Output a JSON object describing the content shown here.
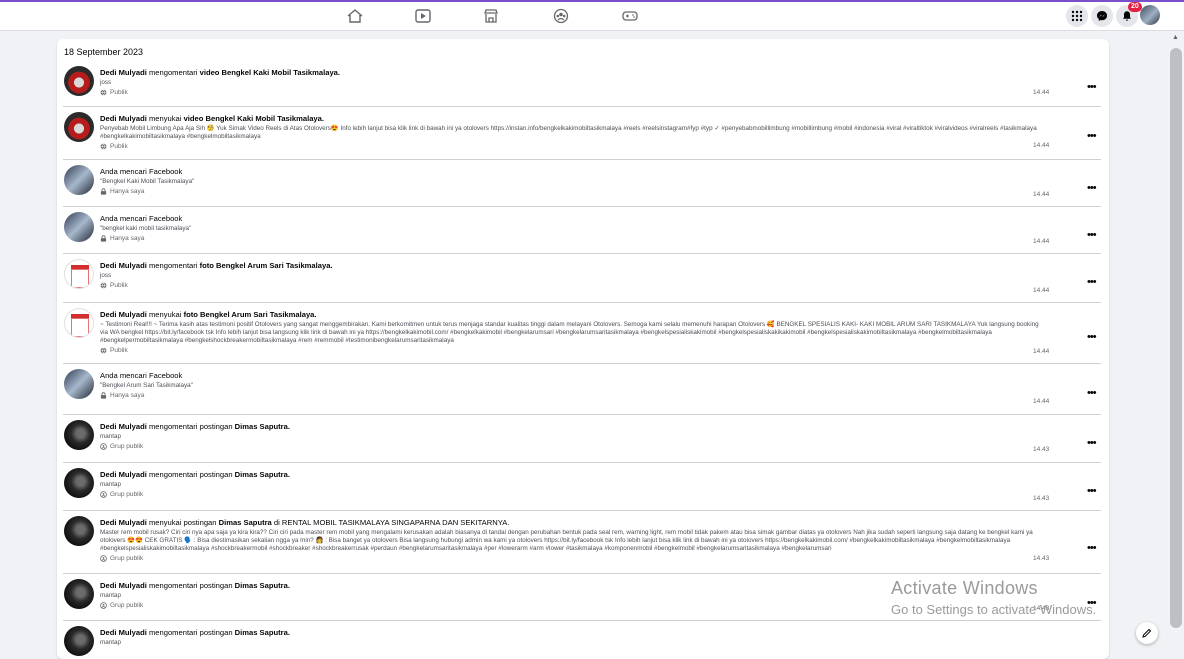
{
  "topbar": {
    "nav_icons": [
      "home-icon",
      "video-icon",
      "marketplace-icon",
      "groups-icon",
      "gaming-icon"
    ],
    "right_icons": [
      "menu-grid-icon",
      "messenger-icon",
      "bell-icon"
    ],
    "notification_count": "20",
    "accent_color": "#7b4fc9"
  },
  "log": {
    "date": "18 September 2023",
    "entries": [
      {
        "avatar": "red",
        "actor": "Dedi Mulyadi",
        "action": " mengomentari ",
        "object": "video Bengkel Kaki Mobil Tasikmalaya.",
        "tail": "",
        "detail": "joss",
        "audience": "Publik",
        "time": "14.44"
      },
      {
        "avatar": "red",
        "actor": "Dedi Mulyadi",
        "action": " menyukai ",
        "object": "video Bengkel Kaki Mobil Tasikmalaya.",
        "tail": "",
        "detail": "Penyebab Mobil Limbung Apa Aja Sih 🧐 Yuk Simak Video Reels di Atas Otolovers😍 Info lebih lanjut bisa klik link di bawah ini ya otolovers https://instan.info/bengkelkakimobiltasikmalaya #reels #reelsinstagram#fyp #typ ✓ #penyebabmobillimbung #mobillimbung #mobil #indonesia #viral #viraltiktok #viralvideos #viralreels #tasikmalaya #bengkelkakimobiltasikmalaya #bengkelmobiltasikmalaya",
        "audience": "Publik",
        "time": "14.44"
      },
      {
        "avatar": "self",
        "actor": "",
        "action": "Anda mencari Facebook",
        "object": "",
        "tail": "",
        "detail": "\"Bengkel Kaki Mobil Tasikmalaya\"",
        "audience": "Hanya saya",
        "time": "14.44"
      },
      {
        "avatar": "self",
        "actor": "",
        "action": "Anda mencari Facebook",
        "object": "",
        "tail": "",
        "detail": "\"bengkel kaki mobil tasikmalaya\"",
        "audience": "Hanya saya",
        "time": "14.44"
      },
      {
        "avatar": "doc",
        "actor": "Dedi Mulyadi",
        "action": " mengomentari ",
        "object": "foto Bengkel Arum Sari Tasikmalaya.",
        "tail": "",
        "detail": "joss",
        "audience": "Publik",
        "time": "14.44"
      },
      {
        "avatar": "doc",
        "actor": "Dedi Mulyadi",
        "action": " menyukai ",
        "object": "foto Bengkel Arum Sari Tasikmalaya.",
        "tail": "",
        "detail": "~ Testimoni Real!!! ~ Terima kasih atas testimoni positif Otolovers yang sangat menggembirakan. Kami berkomitmen untuk terus menjaga standar kualitas tinggi dalam melayani Otolovers. Semoga kami selalu memenuhi harapan Otolovers 🥰 BENGKEL SPESIALIS KAKI- KAKI MOBIL ARUM SARI TASIKMALAYA Yuk langsung booking via WA bengkel https://bit.ly/facebook tsk Info lebih lanjut bisa langsung klik link di bawah ini ya https://bengkelkakimobil.com/ #bengkelkakimobil #bengkelarumsari #bengkelarumsaritasikmalaya #bengkelspesialiskakimobil #bengkelspesialiskakikakimobil #bengkelspesialiskakimobiltasikmalaya #bengkelmobiltasikmalaya #bengkelpermobiltasikmalaya #bengkelshockbreakermobiltasikmalaya #rem #remmobil #testimonibengkelarumsaritasikmalaya",
        "audience": "Publik",
        "time": "14.44"
      },
      {
        "avatar": "self",
        "actor": "",
        "action": "Anda mencari Facebook",
        "object": "",
        "tail": "",
        "detail": "\"Bengkel Arum Sari Tasikmalaya\"",
        "audience": "Hanya saya",
        "time": "14.44"
      },
      {
        "avatar": "dark",
        "actor": "Dedi Mulyadi",
        "action": " mengomentari postingan ",
        "object": "Dimas Saputra.",
        "tail": "",
        "detail": "mantap",
        "audience": "Grup publik",
        "time": "14.43"
      },
      {
        "avatar": "dark",
        "actor": "Dedi Mulyadi",
        "action": " mengomentari postingan ",
        "object": "Dimas Saputra.",
        "tail": "",
        "detail": "mantap",
        "audience": "Grup publik",
        "time": "14.43"
      },
      {
        "avatar": "dark",
        "actor": "Dedi Mulyadi",
        "action": " menyukai postingan ",
        "object": "Dimas Saputra",
        "tail": " di RENTAL MOBIL TASIKMALAYA SINGAPARNA DAN SEKITARNYA.",
        "detail": "Master rem mobil rusak? Ciri ciri nya apa saja ya kira kira?? Ciri ciri pada master rem mobil yang mengalami kerusakan adalah biasanya di tandai dengan perubahan bentuk pada seal rem, warning light, rem mobil tidak pakem atau bisa simak gambar diatas ya otolovers Nah jika sudah seperti langsung saja datang ke bengkel kami ya otolovers 😍😍 CEK GRATIS 🗣️ : Bisa diestimasikan sekalian ngga ya min? 👩 : Bisa banget ya otolovers Bisa langsung hubungi admin wa kami ya otolovers https://bit.ly/facebook tsk Info lebih lanjut bisa klik link di bawah ini ya otolovers https://bengkelkakimobil.com/ #bengkelkakimobiltasikmalaya #bengkelmobiltasikmalaya #bengkelspesialiskakimobiltasikmalaya #shockbreakermobil #shockbreaker #shockbreakerrusak #perdaun #bengkelarumsaritasikmalaya #per #lowerarm #arm #lower #tasikmalaya #komponenmobil #bengkelmobil #bengkelarumsaritasikmalaya #bengkelarumsari",
        "audience": "Grup publik",
        "time": "14.43"
      },
      {
        "avatar": "dark",
        "actor": "Dedi Mulyadi",
        "action": " mengomentari postingan ",
        "object": "Dimas Saputra.",
        "tail": "",
        "detail": "mantap",
        "audience": "Grup publik",
        "time": "14.43"
      },
      {
        "avatar": "dark",
        "actor": "Dedi Mulyadi",
        "action": " mengomentari postingan ",
        "object": "Dimas Saputra.",
        "tail": "",
        "detail": "mantap",
        "audience": "",
        "time": ""
      }
    ]
  },
  "watermark": {
    "line1": "Activate Windows",
    "line2": "Go to Settings to activate Windows."
  }
}
